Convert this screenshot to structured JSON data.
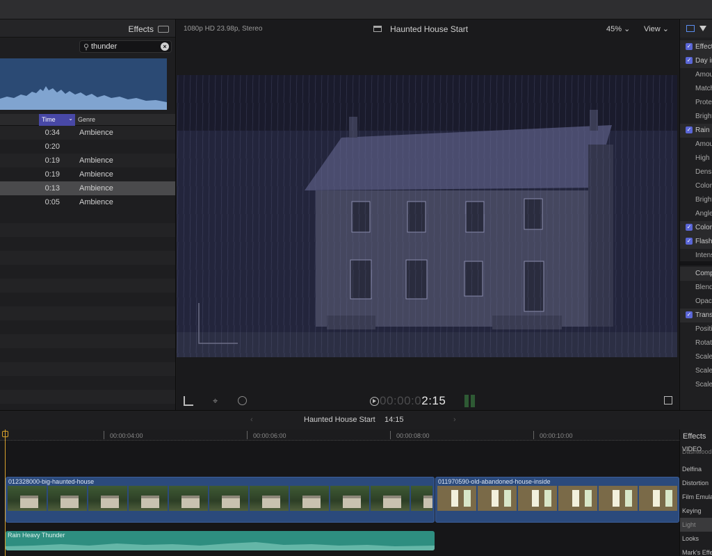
{
  "browser": {
    "title": "Effects",
    "search": {
      "value": "thunder",
      "clear_icon": "close-circle-icon"
    },
    "columns": {
      "time": "Time",
      "genre": "Genre"
    },
    "rows": [
      {
        "time": "0:34",
        "genre": "Ambience"
      },
      {
        "time": "0:20",
        "genre": ""
      },
      {
        "time": "0:19",
        "genre": "Ambience"
      },
      {
        "time": "0:19",
        "genre": "Ambience"
      },
      {
        "time": "0:13",
        "genre": "Ambience"
      },
      {
        "time": "0:05",
        "genre": "Ambience"
      }
    ],
    "selected_row": 4
  },
  "viewer": {
    "format": "1080p HD 23.98p, Stereo",
    "title": "Haunted House Start",
    "zoom": "45%",
    "view": "View",
    "timecode_dim": "00:00:0",
    "timecode_lit": "2:15"
  },
  "inspector": {
    "rows": [
      {
        "type": "head",
        "checked": true,
        "label": "Effects"
      },
      {
        "type": "head",
        "checked": true,
        "label": "Day into Night"
      },
      {
        "type": "param",
        "label": "Amount"
      },
      {
        "type": "param",
        "label": "Match"
      },
      {
        "type": "param",
        "label": "Protect"
      },
      {
        "type": "param",
        "label": "Brightness"
      },
      {
        "type": "head",
        "checked": true,
        "label": "Rain"
      },
      {
        "type": "param",
        "label": "Amount"
      },
      {
        "type": "param",
        "label": "High"
      },
      {
        "type": "param",
        "label": "Density"
      },
      {
        "type": "param",
        "label": "Color"
      },
      {
        "type": "param",
        "label": "Brightness"
      },
      {
        "type": "param",
        "label": "Angle"
      },
      {
        "type": "head",
        "checked": true,
        "label": "Color"
      },
      {
        "type": "head",
        "checked": true,
        "label": "Flash"
      },
      {
        "type": "param",
        "label": "Intensity"
      },
      {
        "type": "head",
        "checked": false,
        "label": "Compositing"
      },
      {
        "type": "param",
        "label": "Blend"
      },
      {
        "type": "param",
        "label": "Opacity"
      },
      {
        "type": "head",
        "checked": true,
        "label": "Transform"
      },
      {
        "type": "param",
        "label": "Position"
      },
      {
        "type": "param",
        "label": "Rotation"
      },
      {
        "type": "param",
        "label": "Scale"
      },
      {
        "type": "param",
        "label": "Scale"
      },
      {
        "type": "param",
        "label": "Scale"
      }
    ]
  },
  "timeline": {
    "title": "Haunted House Start",
    "duration": "14:15",
    "ruler": [
      "00:00:04:00",
      "00:00:06:00",
      "00:00:08:00",
      "00:00:10:00"
    ],
    "clips": [
      {
        "name": "012328000-big-haunted-house",
        "kind": "house"
      },
      {
        "name": "011970590-old-abandoned-house-inside",
        "kind": "inside"
      }
    ],
    "audio_clip": "Rain Heavy Thunder"
  },
  "effects_browser": {
    "title": "Effects",
    "category": "VIDEO",
    "items": [
      "Dashwood",
      "Delfina",
      "Distortion",
      "Film Emulation",
      "Keying",
      "Light",
      "Looks",
      "Mark's Effects"
    ],
    "selected": "Light"
  },
  "colors": {
    "accent": "#5a66d6",
    "playhead": "#d9a22c",
    "video_clip": "#2b4a7c",
    "audio_clip": "#2e8e80"
  }
}
